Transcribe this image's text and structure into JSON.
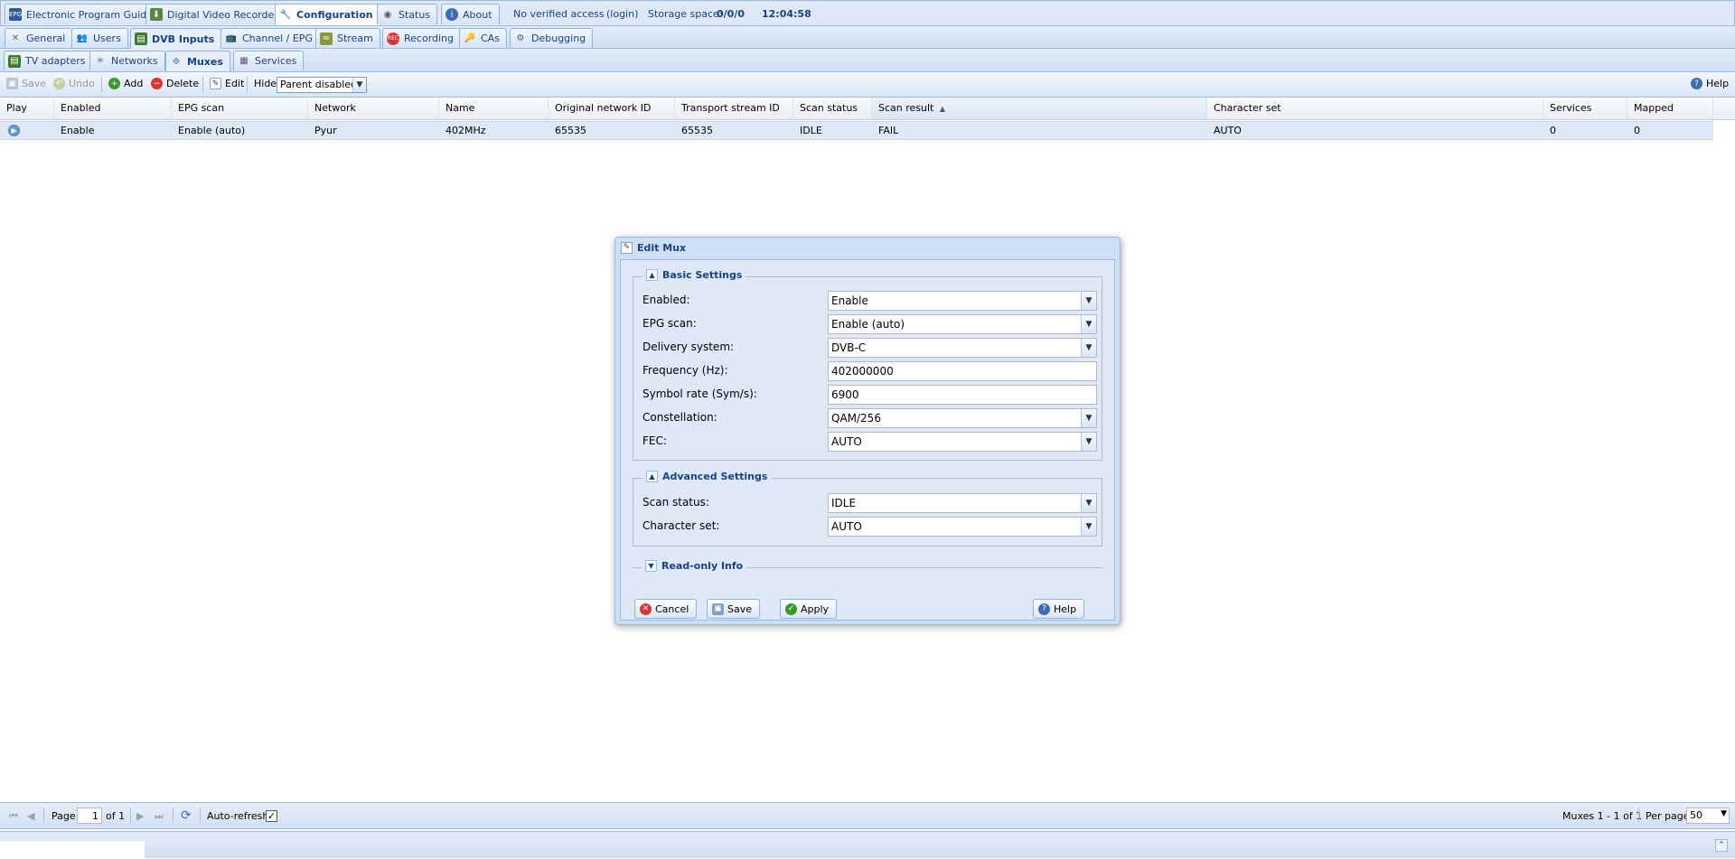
{
  "top_tabs": [
    {
      "label": "Electronic Program Guide"
    },
    {
      "label": "Digital Video Recorder"
    },
    {
      "label": "Configuration"
    },
    {
      "label": "Status"
    },
    {
      "label": "About"
    }
  ],
  "top_status": {
    "access": "No verified access",
    "login": "(login)",
    "storage_label": "Storage space:",
    "storage_value": "0/0/0",
    "time": "12:04:58"
  },
  "config_tabs": [
    {
      "label": "General"
    },
    {
      "label": "Users"
    },
    {
      "label": "DVB Inputs"
    },
    {
      "label": "Channel / EPG"
    },
    {
      "label": "Stream"
    },
    {
      "label": "Recording"
    },
    {
      "label": "CAs"
    },
    {
      "label": "Debugging"
    }
  ],
  "dvb_tabs": [
    {
      "label": "TV adapters"
    },
    {
      "label": "Networks"
    },
    {
      "label": "Muxes"
    },
    {
      "label": "Services"
    }
  ],
  "toolbar": {
    "save": "Save",
    "undo": "Undo",
    "add": "Add",
    "delete": "Delete",
    "edit": "Edit",
    "hide_label": "Hide:",
    "hide_value": "Parent disabled",
    "help": "Help"
  },
  "grid": {
    "columns": [
      "Play",
      "Enabled",
      "EPG scan",
      "Network",
      "Name",
      "Original network ID",
      "Transport stream ID",
      "Scan status",
      "Scan result",
      "Character set",
      "Services",
      "Mapped"
    ],
    "sorted_column": "Scan result",
    "rows": [
      [
        "",
        "Enable",
        "Enable (auto)",
        "Pyur",
        "402MHz",
        "65535",
        "65535",
        "IDLE",
        "FAIL",
        "AUTO",
        "0",
        "0"
      ]
    ]
  },
  "pager": {
    "page_label": "Page",
    "page_value": "1",
    "of_label": "of 1",
    "auto_refresh": "Auto-refresh",
    "summary": "Muxes 1 - 1 of 1",
    "per_page_label": "Per page",
    "per_page_value": "50"
  },
  "dialog": {
    "title": "Edit Mux",
    "basic_title": "Basic Settings",
    "basic_fields": [
      {
        "label": "Enabled:",
        "value": "Enable",
        "type": "select"
      },
      {
        "label": "EPG scan:",
        "value": "Enable (auto)",
        "type": "select"
      },
      {
        "label": "Delivery system:",
        "value": "DVB-C",
        "type": "select"
      },
      {
        "label": "Frequency (Hz):",
        "value": "402000000",
        "type": "text"
      },
      {
        "label": "Symbol rate (Sym/s):",
        "value": "6900",
        "type": "text"
      },
      {
        "label": "Constellation:",
        "value": "QAM/256",
        "type": "select"
      },
      {
        "label": "FEC:",
        "value": "AUTO",
        "type": "select"
      }
    ],
    "advanced_title": "Advanced Settings",
    "advanced_fields": [
      {
        "label": "Scan status:",
        "value": "IDLE",
        "type": "select"
      },
      {
        "label": "Character set:",
        "value": "AUTO",
        "type": "select"
      }
    ],
    "readonly_title": "Read-only Info",
    "buttons": {
      "cancel": "Cancel",
      "save": "Save",
      "apply": "Apply",
      "help": "Help"
    }
  }
}
